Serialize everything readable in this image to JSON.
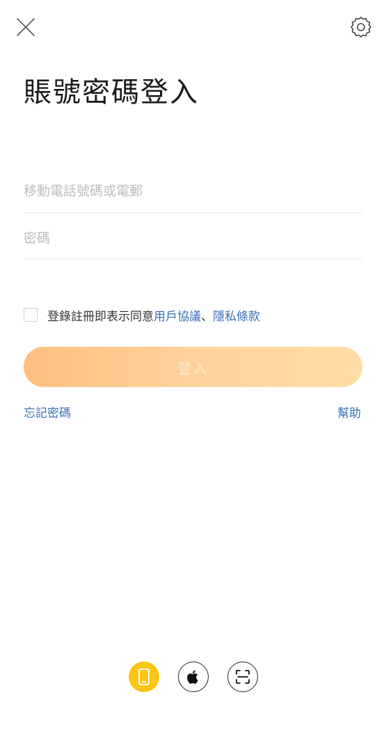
{
  "header": {
    "close_icon": "close-icon",
    "settings_icon": "gear-icon"
  },
  "title": "賬號密碼登入",
  "form": {
    "phone_placeholder": "移動電話號碼或電郵",
    "phone_value": "",
    "password_placeholder": "密碼",
    "password_value": ""
  },
  "agreement": {
    "checked": false,
    "prefix": "登錄註冊即表示同意",
    "user_agreement": "用戶協議",
    "separator": "、",
    "privacy": "隱私條款"
  },
  "login_button": "登入",
  "links": {
    "forgot_password": "忘記密碼",
    "help": "幫助"
  },
  "login_methods": [
    {
      "name": "phone",
      "icon": "phone-icon",
      "active": true
    },
    {
      "name": "apple",
      "icon": "apple-icon",
      "active": false
    },
    {
      "name": "scan",
      "icon": "scan-icon",
      "active": false
    }
  ],
  "colors": {
    "accent": "#ffc414",
    "link": "#3a6fb5",
    "button_start": "#ffbf80",
    "button_end": "#ffdda5"
  }
}
